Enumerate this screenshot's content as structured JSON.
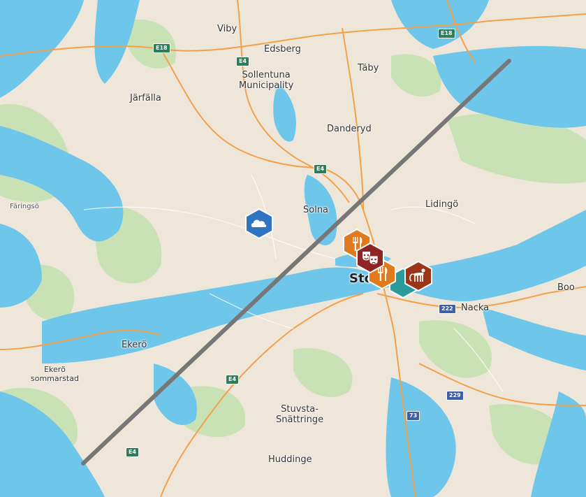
{
  "map": {
    "places": {
      "viby": "Viby",
      "edsberg": "Edsberg",
      "sollentuna": "Sollentuna\nMunicipality",
      "taby": "Täby",
      "jarfalla": "Järfälla",
      "danderyd": "Danderyd",
      "solna": "Solna",
      "lidingo": "Lidingö",
      "faringso": "Färingsö",
      "stockholm": "Sto",
      "boo": "Boo",
      "nacka": "Nacka",
      "ekero": "Ekerö",
      "ekero_sommarstad": "Ekerö\nsommarstad",
      "stuvsta": "Stuvsta-\nSnättringe",
      "huddinge": "Huddinge"
    },
    "roads": {
      "e18_top": "E18",
      "e18_left": "E18",
      "e4_north": "E4",
      "e4_mid": "E4",
      "e4_south": "E4",
      "e4_sw": "E4",
      "r222": "222",
      "r229": "229",
      "r73": "73"
    },
    "markers": [
      {
        "icon": "cloud-icon",
        "color": "#2f74c0"
      },
      {
        "icon": "restaurant-icon",
        "color": "#e07a1f"
      },
      {
        "icon": "theater-icon",
        "color": "#8e2424"
      },
      {
        "icon": "restaurant-icon",
        "color": "#e07a1f"
      },
      {
        "icon": "zoo-icon",
        "color": "#9a3517"
      }
    ],
    "colors": {
      "land": "#efe6da",
      "water": "#6ec6ea",
      "park": "#c9e2b5",
      "road": "#f3a04a",
      "route_line": "#777777"
    }
  }
}
